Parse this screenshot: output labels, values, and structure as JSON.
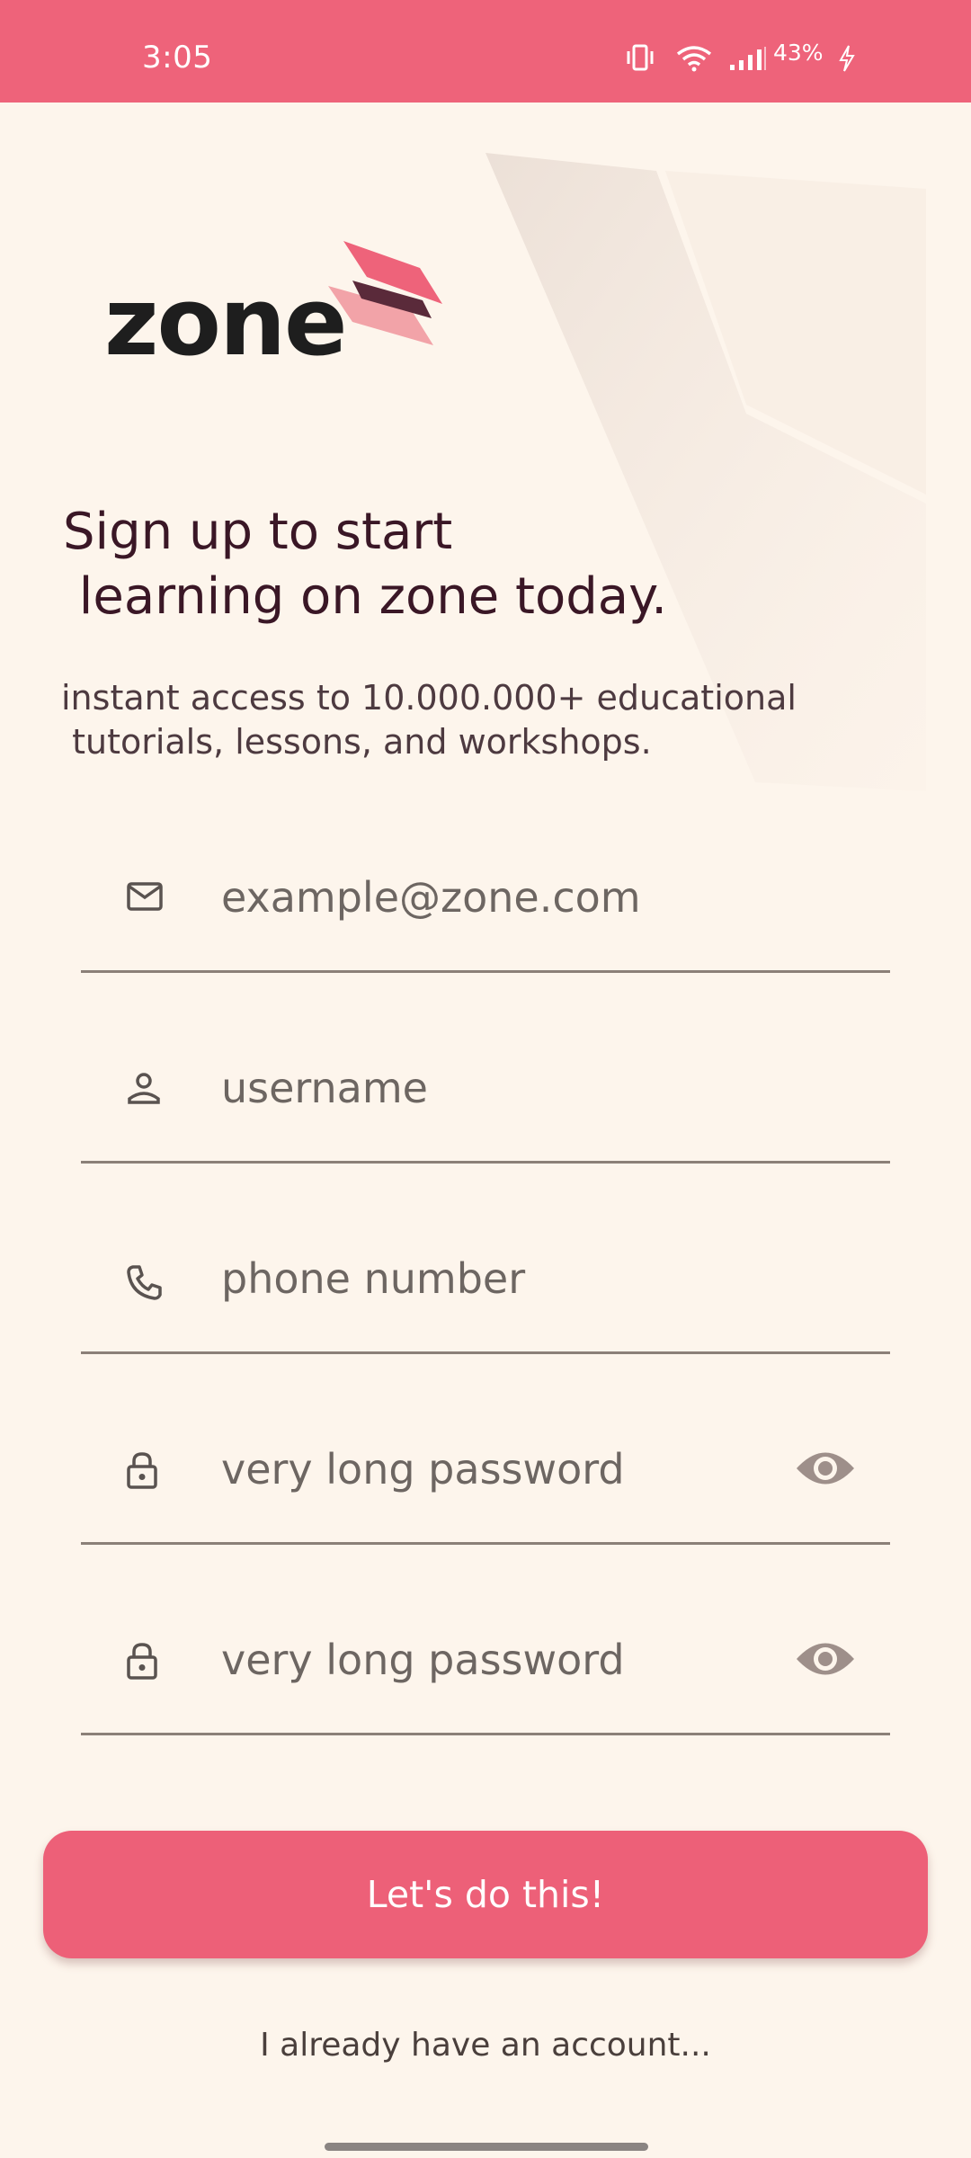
{
  "status_bar": {
    "time": "3:05",
    "battery": "43%",
    "icons": [
      "vibrate-icon",
      "wifi-icon",
      "signal-icon",
      "battery-charging-icon"
    ]
  },
  "brand": {
    "logo_text": "zone",
    "logo_icon": "zone-logo-mark",
    "accent": "#ee637a",
    "logo_dark": "#5a2a3a",
    "logo_light": "#f2a3a8"
  },
  "headline": "Sign up to start\n learning on zone today.",
  "subtitle": "instant access to 10.000.000+ educational\n tutorials, lessons, and workshops.",
  "form": {
    "email": {
      "placeholder": "example@zone.com",
      "value": "",
      "icon": "mail-icon"
    },
    "username": {
      "placeholder": "username",
      "value": "",
      "icon": "person-icon"
    },
    "phone": {
      "placeholder": "phone number",
      "value": "",
      "icon": "phone-icon"
    },
    "password": {
      "placeholder": "very long password",
      "value": "",
      "icon": "lock-icon",
      "toggle_icon": "eye-icon"
    },
    "confirm_password": {
      "placeholder": "very long password",
      "value": "",
      "icon": "lock-icon",
      "toggle_icon": "eye-icon"
    }
  },
  "cta_label": "Let's do this!",
  "login_link": "I already have an account..."
}
